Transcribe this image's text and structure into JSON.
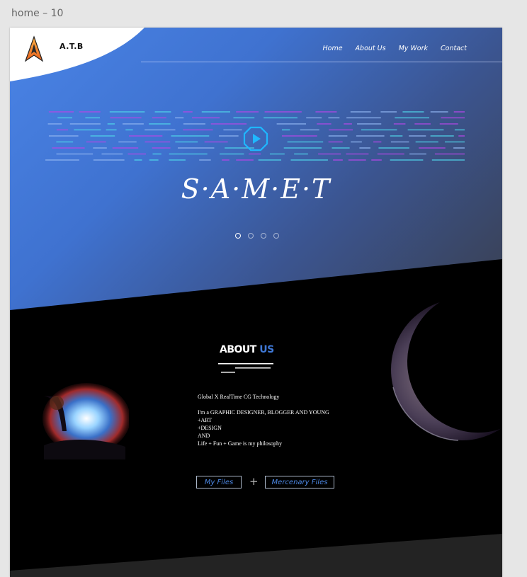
{
  "frame": {
    "title": "home – 10"
  },
  "header": {
    "logo_text": "A.T.B",
    "nav": [
      "Home",
      "About Us",
      "My Work",
      "Contact"
    ]
  },
  "hero": {
    "name": "S·A·M·E·T",
    "slider_active_index": 0,
    "slider_count": 4
  },
  "about": {
    "title_main": "ABOUT",
    "title_accent": "US",
    "lines": [
      "Global X RealTime CG Technology",
      "",
      "I'm a GRAPHIC DESIGNER, BLOGGER AND YOUNG",
      "+ART",
      "+DESIGN",
      "AND",
      "Life + Fun + Game  is my philosophy"
    ]
  },
  "buttons": {
    "my_files": "My Files",
    "separator": "+",
    "mercenary_files": "Mercenary Files"
  },
  "colors": {
    "accent_blue": "#3f78d6",
    "hero_start": "#4a84e6",
    "hero_end": "#3a3f4f",
    "dash_magenta": "#b347e6",
    "dash_cyan": "#4fd3e8"
  }
}
